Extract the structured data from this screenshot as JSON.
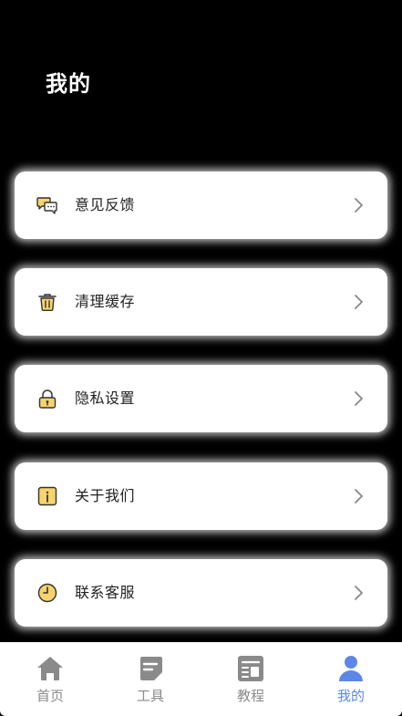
{
  "header": {
    "title": "我的"
  },
  "menu": {
    "items": [
      {
        "label": "意见反馈",
        "icon": "feedback-chat-icon"
      },
      {
        "label": "清理缓存",
        "icon": "trash-bin-icon"
      },
      {
        "label": "隐私设置",
        "icon": "lock-icon"
      },
      {
        "label": "关于我们",
        "icon": "info-icon"
      },
      {
        "label": "联系客服",
        "icon": "clock-icon"
      }
    ]
  },
  "tabbar": {
    "tabs": [
      {
        "label": "首页",
        "icon": "home-icon",
        "active": false
      },
      {
        "label": "工具",
        "icon": "tools-icon",
        "active": false
      },
      {
        "label": "教程",
        "icon": "tutorial-icon",
        "active": false
      },
      {
        "label": "我的",
        "icon": "user-icon",
        "active": true
      }
    ]
  },
  "colors": {
    "background": "#000000",
    "card": "#ffffff",
    "icon_accent": "#f7d36b",
    "active_tab": "#5b87e8",
    "inactive_tab": "#8a8a8a"
  }
}
